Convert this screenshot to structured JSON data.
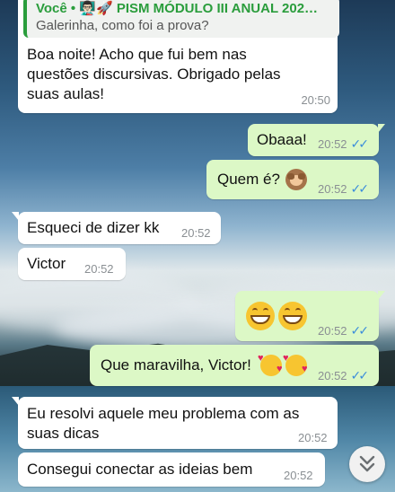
{
  "reply": {
    "quote_author": "Você • 👨🏻‍🏫🚀 PISM MÓDULO III ANUAL 202…",
    "quote_text": "Galerinha, como foi a prova?",
    "text_line1": "Boa noite! Acho que fui bem nas",
    "text_line2": "questões discursivas. Obrigado pelas",
    "text_line3": "suas aulas!",
    "time": "20:50"
  },
  "messages": [
    {
      "id": "m1",
      "text": "Obaaa!",
      "time": "20:52",
      "direction": "out"
    },
    {
      "id": "m2",
      "text": "Quem é?",
      "time": "20:52",
      "direction": "out",
      "emoji": "see-no-evil-monkey"
    },
    {
      "id": "m3",
      "text": "Esqueci de dizer kk",
      "time": "20:52",
      "direction": "in"
    },
    {
      "id": "m4",
      "text": "Victor",
      "time": "20:52",
      "direction": "in"
    },
    {
      "id": "m5",
      "text": "",
      "time": "20:52",
      "direction": "out",
      "emoji": "grinning-faces"
    },
    {
      "id": "m6",
      "text": "Que maravilha, Victor!",
      "time": "20:52",
      "direction": "out",
      "emoji": "smiling-face-with-hearts"
    },
    {
      "id": "m7",
      "text_line1": "Eu resolvi aquele meu problema com as",
      "text_line2": "suas dicas",
      "time": "20:52",
      "direction": "in"
    },
    {
      "id": "m8",
      "text": "Consegui conectar as ideias bem",
      "time": "20:52",
      "direction": "in"
    }
  ],
  "read_receipt": "✓✓",
  "colors": {
    "incoming": "#ffffff",
    "outgoing": "#dcf8c6",
    "read_tick": "#3b8ddb",
    "quote_accent": "#2a9d3c"
  },
  "icons": {
    "scroll_down": "double-chevron-down-icon"
  }
}
